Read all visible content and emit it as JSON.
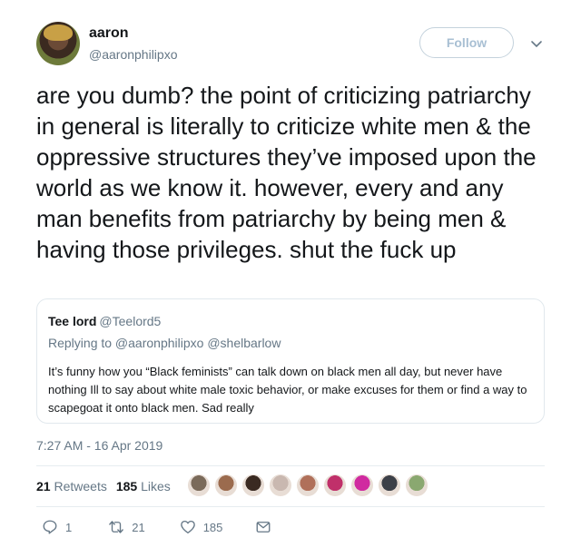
{
  "author": {
    "name": "aaron",
    "handle": "@aaronphilipxo",
    "follow_label": "Follow"
  },
  "tweet": {
    "text": "are you dumb? the point of criticizing patriarchy in general is literally to criticize white men & the oppressive structures they’ve imposed upon the world as we know it. however, every and any man benefits from patriarchy by being men & having those privileges. shut the fuck up",
    "timestamp": "7:27 AM - 16 Apr 2019"
  },
  "quoted": {
    "name": "Tee lord",
    "handle": "@Teelord5",
    "replying_to": "Replying to @aaronphilipxo @shelbarlow",
    "text": "It’s funny how you “Black feminists” can talk down on black men all day, but never have nothing Ill to say about white male toxic behavior, or make excuses for them or find a way to scapegoat it onto black men. Sad really"
  },
  "stats": {
    "retweets_count": "21",
    "retweets_label": "Retweets",
    "likes_count": "185",
    "likes_label": "Likes"
  },
  "liker_avatars": [
    {
      "icon": "avatar-1",
      "color": "#7a6a5a"
    },
    {
      "icon": "avatar-2",
      "color": "#9b6b4e"
    },
    {
      "icon": "avatar-3",
      "color": "#3a2a22"
    },
    {
      "icon": "avatar-4",
      "color": "#c9b8b0"
    },
    {
      "icon": "avatar-5",
      "color": "#b0705a"
    },
    {
      "icon": "avatar-6",
      "color": "#c0306a"
    },
    {
      "icon": "avatar-7",
      "color": "#d02aa0"
    },
    {
      "icon": "avatar-8",
      "color": "#3c4048"
    },
    {
      "icon": "avatar-9",
      "color": "#8aa870"
    }
  ],
  "actions": {
    "reply_count": "1",
    "retweet_count": "21",
    "like_count": "185"
  },
  "colors": {
    "text": "#14171a",
    "secondary": "#657786",
    "border": "#e1e8ed"
  }
}
